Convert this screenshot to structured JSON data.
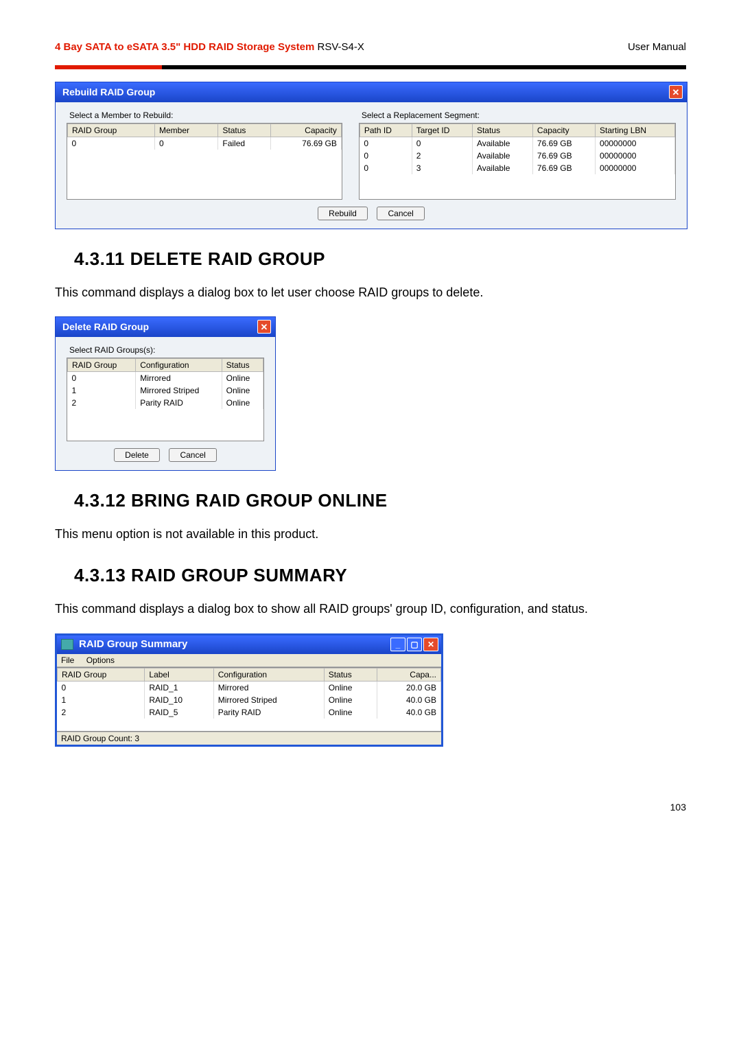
{
  "header": {
    "title_bold": "4 Bay SATA to eSATA 3.5\" HDD RAID Storage System",
    "title_tail": " RSV-S4-X",
    "right": "User Manual"
  },
  "rebuild": {
    "title": "Rebuild RAID Group",
    "left_label": "Select a Member to Rebuild:",
    "left_cols": [
      "RAID Group",
      "Member",
      "Status",
      "Capacity"
    ],
    "left_rows": [
      [
        "0",
        "0",
        "Failed",
        "76.69 GB"
      ]
    ],
    "right_label": "Select a Replacement Segment:",
    "right_cols": [
      "Path ID",
      "Target ID",
      "Status",
      "Capacity",
      "Starting LBN"
    ],
    "right_rows": [
      [
        "0",
        "0",
        "Available",
        "76.69 GB",
        "00000000"
      ],
      [
        "0",
        "2",
        "Available",
        "76.69 GB",
        "00000000"
      ],
      [
        "0",
        "3",
        "Available",
        "76.69 GB",
        "00000000"
      ]
    ],
    "btn_rebuild": "Rebuild",
    "btn_cancel": "Cancel"
  },
  "sec11": {
    "heading": "4.3.11   DELETE RAID GROUP",
    "text": "This command displays a dialog box to let user choose RAID groups to delete."
  },
  "delete": {
    "title": "Delete RAID Group",
    "label": "Select RAID Groups(s):",
    "cols": [
      "RAID Group",
      "Configuration",
      "Status"
    ],
    "rows": [
      [
        "0",
        "Mirrored",
        "Online"
      ],
      [
        "1",
        "Mirrored Striped",
        "Online"
      ],
      [
        "2",
        "Parity RAID",
        "Online"
      ]
    ],
    "btn_delete": "Delete",
    "btn_cancel": "Cancel"
  },
  "sec12": {
    "heading": "4.3.12   BRING RAID GROUP ONLINE",
    "text": "This menu option is not available in this product."
  },
  "sec13": {
    "heading": "4.3.13   RAID GROUP SUMMARY",
    "text": "This command displays a dialog box to show all RAID groups' group ID, configuration, and status."
  },
  "summary": {
    "title": "RAID Group Summary",
    "menu": [
      "File",
      "Options"
    ],
    "cols": [
      "RAID Group",
      "Label",
      "Configuration",
      "Status",
      "Capa..."
    ],
    "rows": [
      [
        "0",
        "RAID_1",
        "Mirrored",
        "Online",
        "20.0 GB"
      ],
      [
        "1",
        "RAID_10",
        "Mirrored Striped",
        "Online",
        "40.0 GB"
      ],
      [
        "2",
        "RAID_5",
        "Parity RAID",
        "Online",
        "40.0 GB"
      ]
    ],
    "status": "RAID Group Count: 3"
  },
  "page_number": "103"
}
